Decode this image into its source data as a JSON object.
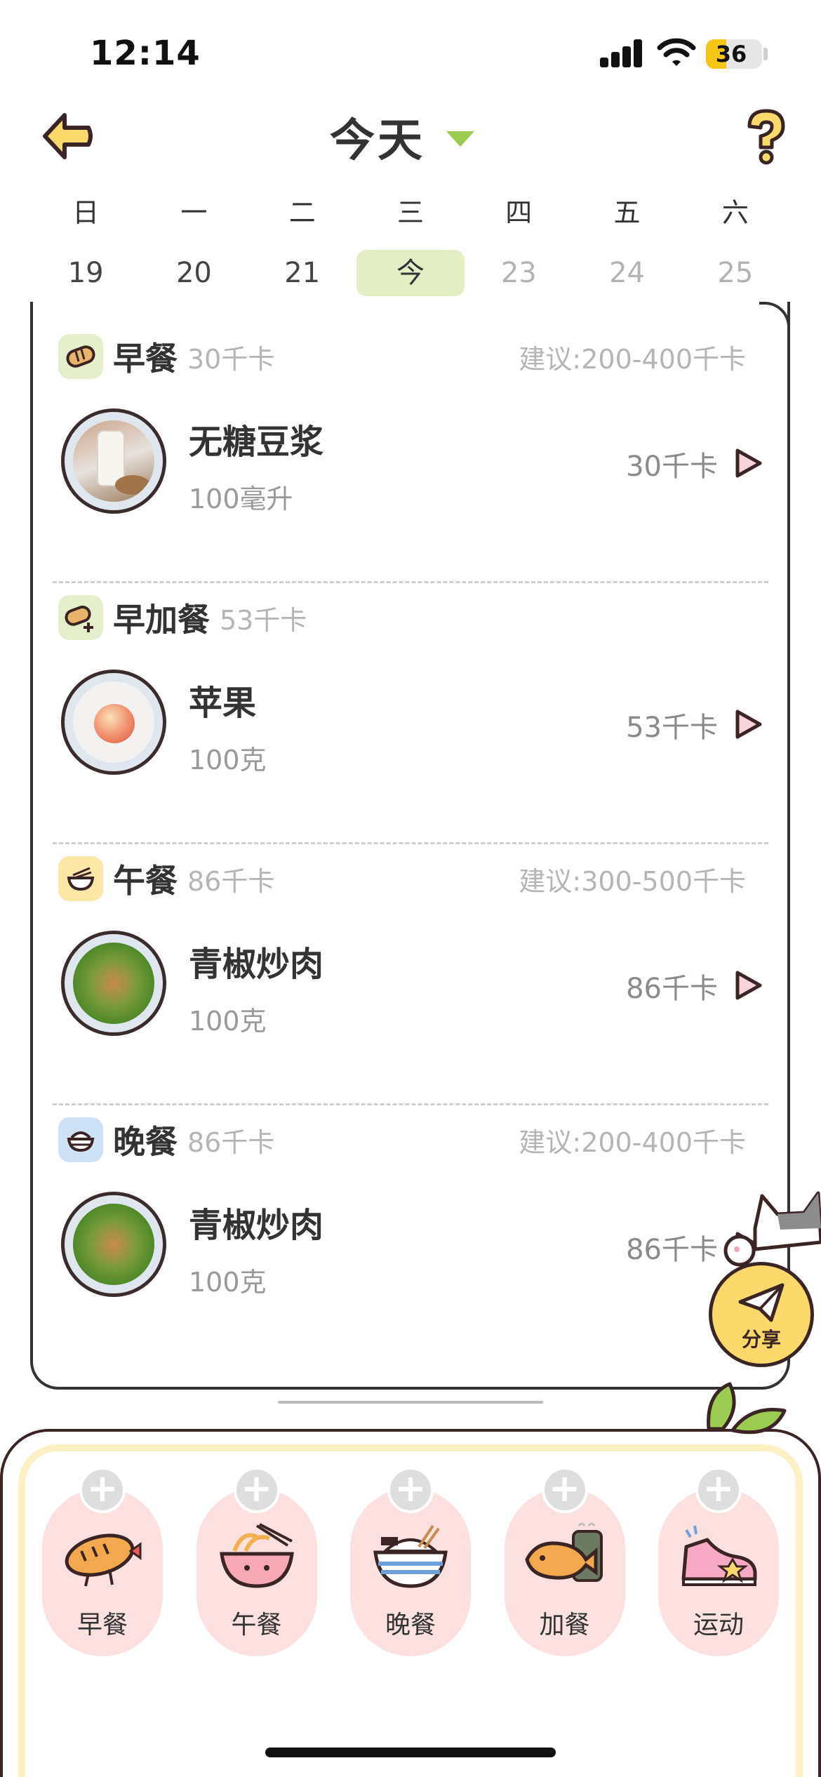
{
  "status_bar": {
    "time": "12:14",
    "battery": "36"
  },
  "header": {
    "title": "今天"
  },
  "week": {
    "weekdays": [
      "日",
      "一",
      "二",
      "三",
      "四",
      "五",
      "六"
    ],
    "dates": [
      "19",
      "20",
      "21",
      "今",
      "23",
      "24",
      "25"
    ],
    "selected_index": 3
  },
  "meals": [
    {
      "name": "早餐",
      "kcal": "30千卡",
      "suggest": "建议:200-400千卡",
      "icon": "bread-icon",
      "icon_bg": "#e6efcc",
      "food": {
        "name": "无糖豆浆",
        "amount": "100毫升",
        "kcal": "30千卡"
      }
    },
    {
      "name": "早加餐",
      "kcal": "53千卡",
      "suggest": "",
      "icon": "bread-plus-icon",
      "icon_bg": "#e6efcc",
      "food": {
        "name": "苹果",
        "amount": "100克",
        "kcal": "53千卡"
      }
    },
    {
      "name": "午餐",
      "kcal": "86千卡",
      "suggest": "建议:300-500千卡",
      "icon": "noodle-bowl-icon",
      "icon_bg": "#fde7a6",
      "food": {
        "name": "青椒炒肉",
        "amount": "100克",
        "kcal": "86千卡"
      }
    },
    {
      "name": "晚餐",
      "kcal": "86千卡",
      "suggest": "建议:200-400千卡",
      "icon": "rice-bowl-icon",
      "icon_bg": "#cfe2f5",
      "food": {
        "name": "青椒炒肉",
        "amount": "100克",
        "kcal": "86千卡"
      }
    }
  ],
  "share": {
    "label": "分享"
  },
  "add_actions": [
    {
      "label": "早餐",
      "icon": "bread-character-icon"
    },
    {
      "label": "午餐",
      "icon": "noodle-bowl-character-icon"
    },
    {
      "label": "晚餐",
      "icon": "rice-bowl-character-icon"
    },
    {
      "label": "加餐",
      "icon": "taiyaki-character-icon"
    },
    {
      "label": "运动",
      "icon": "sneaker-icon"
    }
  ],
  "colors": {
    "accent_green": "#9ccb52",
    "selected_date_bg": "#e3eec4",
    "pill_pink": "#fde1e1",
    "share_yellow": "#fbd96a",
    "outline": "#3b2424"
  }
}
